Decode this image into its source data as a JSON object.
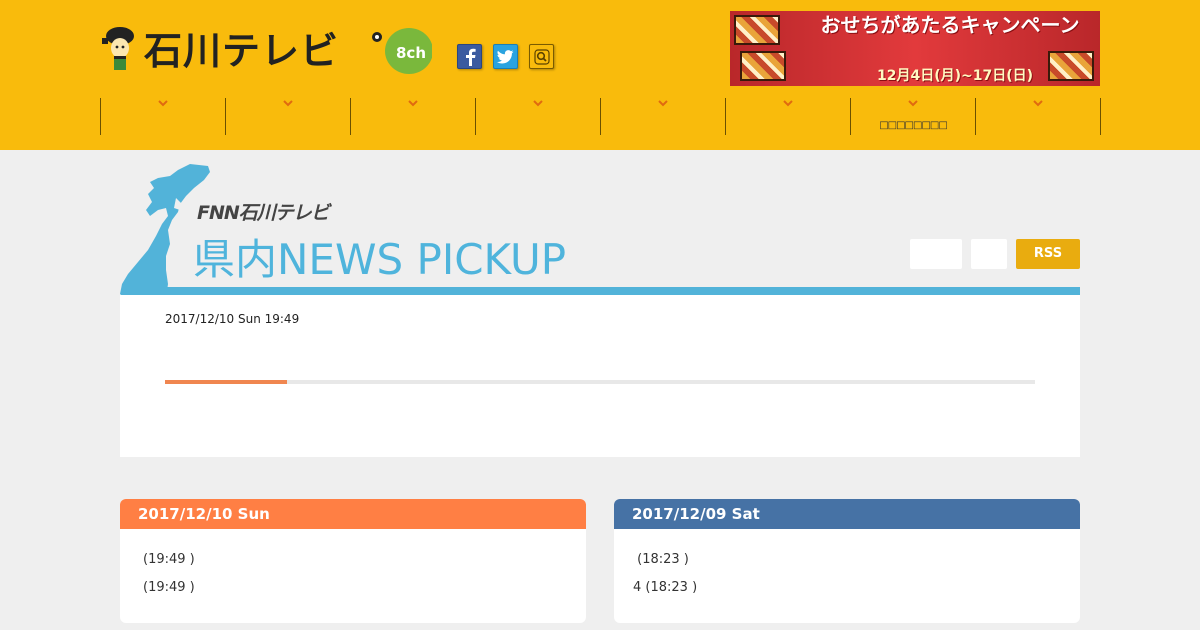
{
  "header": {
    "logo_text": "石川テレビ",
    "channel": "8ch",
    "social": [
      "facebook-icon",
      "twitter-icon",
      "search-icon"
    ],
    "banner": {
      "title": "おせちがあたるキャンペーン",
      "date": "12月4日(月)~17日(日)"
    },
    "nav": [
      {
        "label": ""
      },
      {
        "label": ""
      },
      {
        "label": ""
      },
      {
        "label": ""
      },
      {
        "label": ""
      },
      {
        "label": ""
      },
      {
        "label": "□□□□□□□□"
      },
      {
        "label": ""
      }
    ]
  },
  "section": {
    "fnn_label": "FNN石川テレビ",
    "title": "県内NEWS  PICKUP",
    "buttons": [
      "",
      ""
    ],
    "rss_label": "RSS"
  },
  "feature": {
    "datetime": "2017/12/10 Sun 19:49",
    "progress": 0.14
  },
  "days": [
    {
      "date": "2017/12/10 Sun",
      "items": [
        "(19:49 )",
        "(19:49 )"
      ]
    },
    {
      "date": "2017/12/09 Sat",
      "items": [
        " (18:23 )",
        "4 (18:23 )"
      ]
    }
  ],
  "colors": {
    "header_bg": "#f9bb0c",
    "title_blue": "#4fb4dc",
    "accent_orange": "#f08650",
    "day1_head": "#ff7f44",
    "day2_head": "#4672a5",
    "rss": "#e9ac0f"
  }
}
